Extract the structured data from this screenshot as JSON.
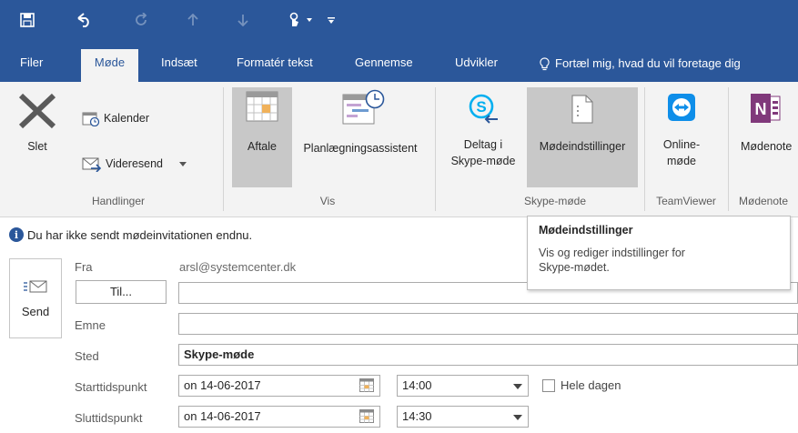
{
  "quick_access": {
    "icons": [
      "save-icon",
      "undo-icon",
      "redo-icon",
      "up-arrow-icon",
      "down-arrow-icon",
      "touch-mode-icon",
      "customize-icon"
    ]
  },
  "tabs": [
    {
      "label": "Filer"
    },
    {
      "label": "Møde",
      "active": true
    },
    {
      "label": "Indsæt"
    },
    {
      "label": "Formatér tekst"
    },
    {
      "label": "Gennemse"
    },
    {
      "label": "Udvikler"
    }
  ],
  "tell_me": "Fortæl mig, hvad du vil foretage dig",
  "ribbon": {
    "slet": "Slet",
    "kalender": "Kalender",
    "videresend": "Videresend",
    "handlinger": "Handlinger",
    "aftale": "Aftale",
    "planlaegning": "Planlægningsassistent",
    "vis": "Vis",
    "deltag1": "Deltag i",
    "deltag2": "Skype-møde",
    "moedeindstillinger": "Mødeindstillinger",
    "skype_group": "Skype-møde",
    "online1": "Online-",
    "online2": "møde",
    "teamviewer": "TeamViewer",
    "moedenote": "Mødenote",
    "moedenote_group": "Mødenote"
  },
  "info_message": "Du har ikke sendt mødeinvitationen endnu.",
  "tooltip": {
    "title": "Mødeindstillinger",
    "body_line1": "Vis og rediger indstillinger for",
    "body_line2": "Skype-mødet."
  },
  "form": {
    "send_label": "Send",
    "fra_label": "Fra",
    "fra_value": "arsl@systemcenter.dk",
    "til_label": "Til...",
    "til_value": "",
    "emne_label": "Emne",
    "emne_value": "",
    "sted_label": "Sted",
    "sted_value": "Skype-møde",
    "start_label": "Starttidspunkt",
    "start_date": "on 14-06-2017",
    "start_time": "14:00",
    "hele_dagen": "Hele dagen",
    "slut_label": "Sluttidspunkt",
    "slut_date": "on 14-06-2017",
    "slut_time": "14:30"
  },
  "colors": {
    "brand": "#2b579a",
    "ribbon_bg": "#f3f3f3",
    "onenote": "#80397b",
    "skype": "#00aff0",
    "teamviewer": "#0e8ee9"
  }
}
